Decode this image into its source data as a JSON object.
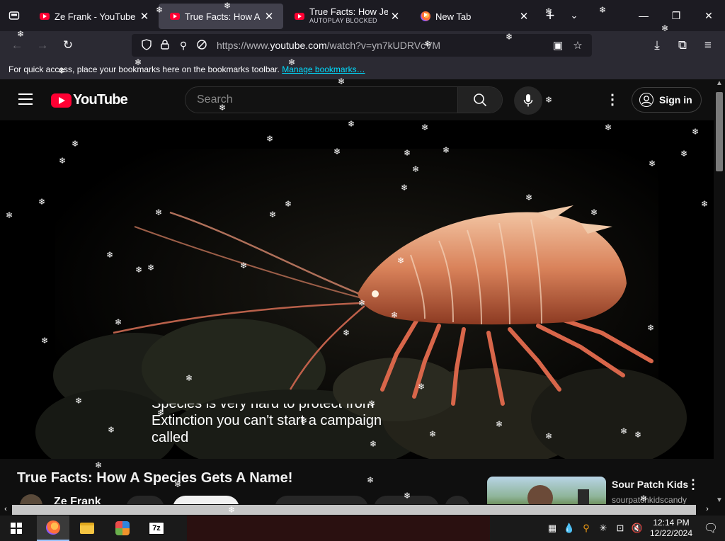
{
  "browser": {
    "tabs": [
      {
        "title": "Ze Frank - YouTube",
        "subtitle": "",
        "favicon": "youtube-icon",
        "active": false
      },
      {
        "title": "True Facts: How A Spec",
        "subtitle": "",
        "favicon": "youtube-icon",
        "active": true
      },
      {
        "title": "True Facts: How Jellyfis",
        "subtitle": "AUTOPLAY BLOCKED",
        "favicon": "youtube-icon",
        "active": false
      },
      {
        "title": "New Tab",
        "subtitle": "",
        "favicon": "firefox-icon",
        "active": false
      }
    ],
    "url_prefix": "https://www.",
    "url_domain": "youtube.com",
    "url_rest": "/watch?v=yn7kUDRVcVM",
    "bookmarks_text": "For quick access, place your bookmarks here on the bookmarks toolbar.",
    "bookmarks_link": "Manage bookmarks…"
  },
  "youtube": {
    "logo_text": "YouTube",
    "search_placeholder": "Search",
    "sign_in": "Sign in",
    "captions": [
      "Species is very hard to protect from",
      "Extinction you can't start a campaign",
      "called"
    ],
    "video_title": "True Facts: How A Species Gets A Name!",
    "channel_name": "Ze Frank",
    "side_video": {
      "title": "Sour Patch Kids",
      "channel": "sourpatchkidscandy"
    }
  },
  "taskbar": {
    "time": "12:14 PM",
    "date": "12/22/2024",
    "pinned": [
      "windows-start-icon",
      "firefox-icon",
      "file-explorer-icon",
      "app-icon",
      "7zip-icon"
    ]
  },
  "colors": {
    "youtube_red": "#ff0033",
    "link_cyan": "#00ddff",
    "tab_active": "#42414d"
  }
}
